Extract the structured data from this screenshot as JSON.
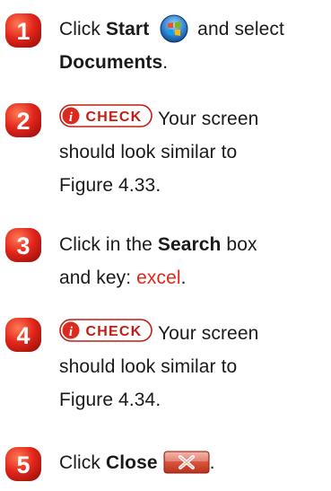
{
  "steps": [
    {
      "num": "1",
      "pre": "Click ",
      "bold1": "Start",
      "mid": " and select",
      "line2_bold": "Documents",
      "line2_end": "."
    },
    {
      "num": "2",
      "check": "CHECK",
      "line1_rest": "Your screen",
      "line2": "should look similar to",
      "line3": "Figure 4.33."
    },
    {
      "num": "3",
      "pre": "Click in the ",
      "bold1": "Search",
      "post": " box",
      "line2_pre": "and key: ",
      "line2_red": "excel",
      "line2_end": "."
    },
    {
      "num": "4",
      "check": "CHECK",
      "line1_rest": "Your screen",
      "line2": "should look similar to",
      "line3": "Figure 4.34."
    },
    {
      "num": "5",
      "pre": "Click ",
      "bold1": "Close",
      "end": "."
    }
  ],
  "colors": {
    "badge": "#e3261c",
    "accent_text": "#e0261b",
    "check_bg": "#dd2a20"
  },
  "icons": {
    "start_button": "windows-start-orb-icon",
    "close_button": "close-x-icon",
    "check_logo": "check-circle-icon"
  }
}
